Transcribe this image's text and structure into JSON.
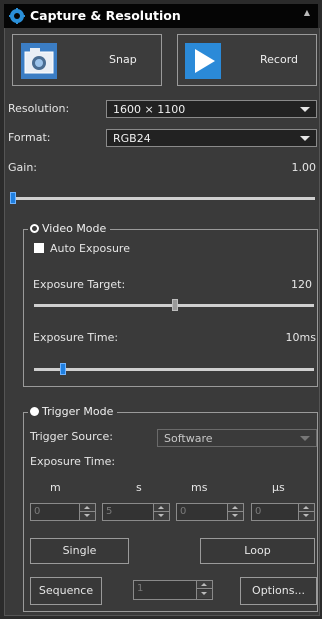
{
  "window": {
    "title": "Capture & Resolution"
  },
  "buttons": {
    "snap": "Snap",
    "record": "Record"
  },
  "resolution": {
    "label": "Resolution:",
    "value": "1600 × 1100"
  },
  "format": {
    "label": "Format:",
    "value": "RGB24"
  },
  "gain": {
    "label": "Gain:",
    "value": "1.00",
    "level_fraction": 0.02
  },
  "video_mode": {
    "title": "Video Mode",
    "auto_exposure_label": "Auto Exposure",
    "auto_exposure_checked": true,
    "exposure_target_label": "Exposure Target:",
    "exposure_target_value": "120",
    "exposure_target_fraction": 0.5,
    "exposure_time_label": "Exposure Time:",
    "exposure_time_value": "10ms",
    "exposure_time_fraction": 0.12
  },
  "trigger_mode": {
    "title": "Trigger Mode",
    "source_label": "Trigger Source:",
    "source_value": "Software",
    "exposure_time_label": "Exposure Time:",
    "units": [
      "m",
      "s",
      "ms",
      "µs"
    ],
    "values": [
      "0",
      "5",
      "0",
      "0"
    ],
    "single_label": "Single",
    "loop_label": "Loop",
    "sequence_label": "Sequence",
    "sequence_value": "1",
    "options_label": "Options..."
  },
  "colors": {
    "accent": "#1f7fe0",
    "background": "#3a3a3a",
    "title_bar": "#050505"
  }
}
